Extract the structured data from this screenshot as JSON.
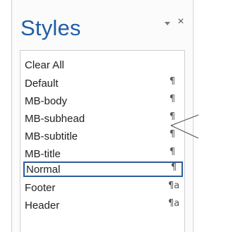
{
  "styles_pane": {
    "title": "Styles",
    "dropdown_icon": "chevron-down-icon",
    "close_icon": "close-icon",
    "close_glyph": "×",
    "items": [
      {
        "label": "Clear All",
        "icon": "",
        "glyph": ""
      },
      {
        "label": "Default",
        "icon": "paragraph-style-icon",
        "glyph": "¶"
      },
      {
        "label": "MB-body",
        "icon": "paragraph-style-icon",
        "glyph": "¶"
      },
      {
        "label": "MB-subhead",
        "icon": "paragraph-style-icon",
        "glyph": "¶"
      },
      {
        "label": "MB-subtitle",
        "icon": "paragraph-style-icon",
        "glyph": "¶"
      },
      {
        "label": "MB-title",
        "icon": "paragraph-style-icon",
        "glyph": "¶"
      },
      {
        "label": "Normal",
        "icon": "paragraph-style-icon",
        "glyph": "¶",
        "selected": true
      },
      {
        "label": "Footer",
        "icon": "linked-style-icon",
        "glyph": "¶a"
      },
      {
        "label": "Header",
        "icon": "linked-style-icon",
        "glyph": "¶a"
      }
    ]
  },
  "colors": {
    "title": "#1f5fa6",
    "selected_border": "#2d5d9b"
  }
}
